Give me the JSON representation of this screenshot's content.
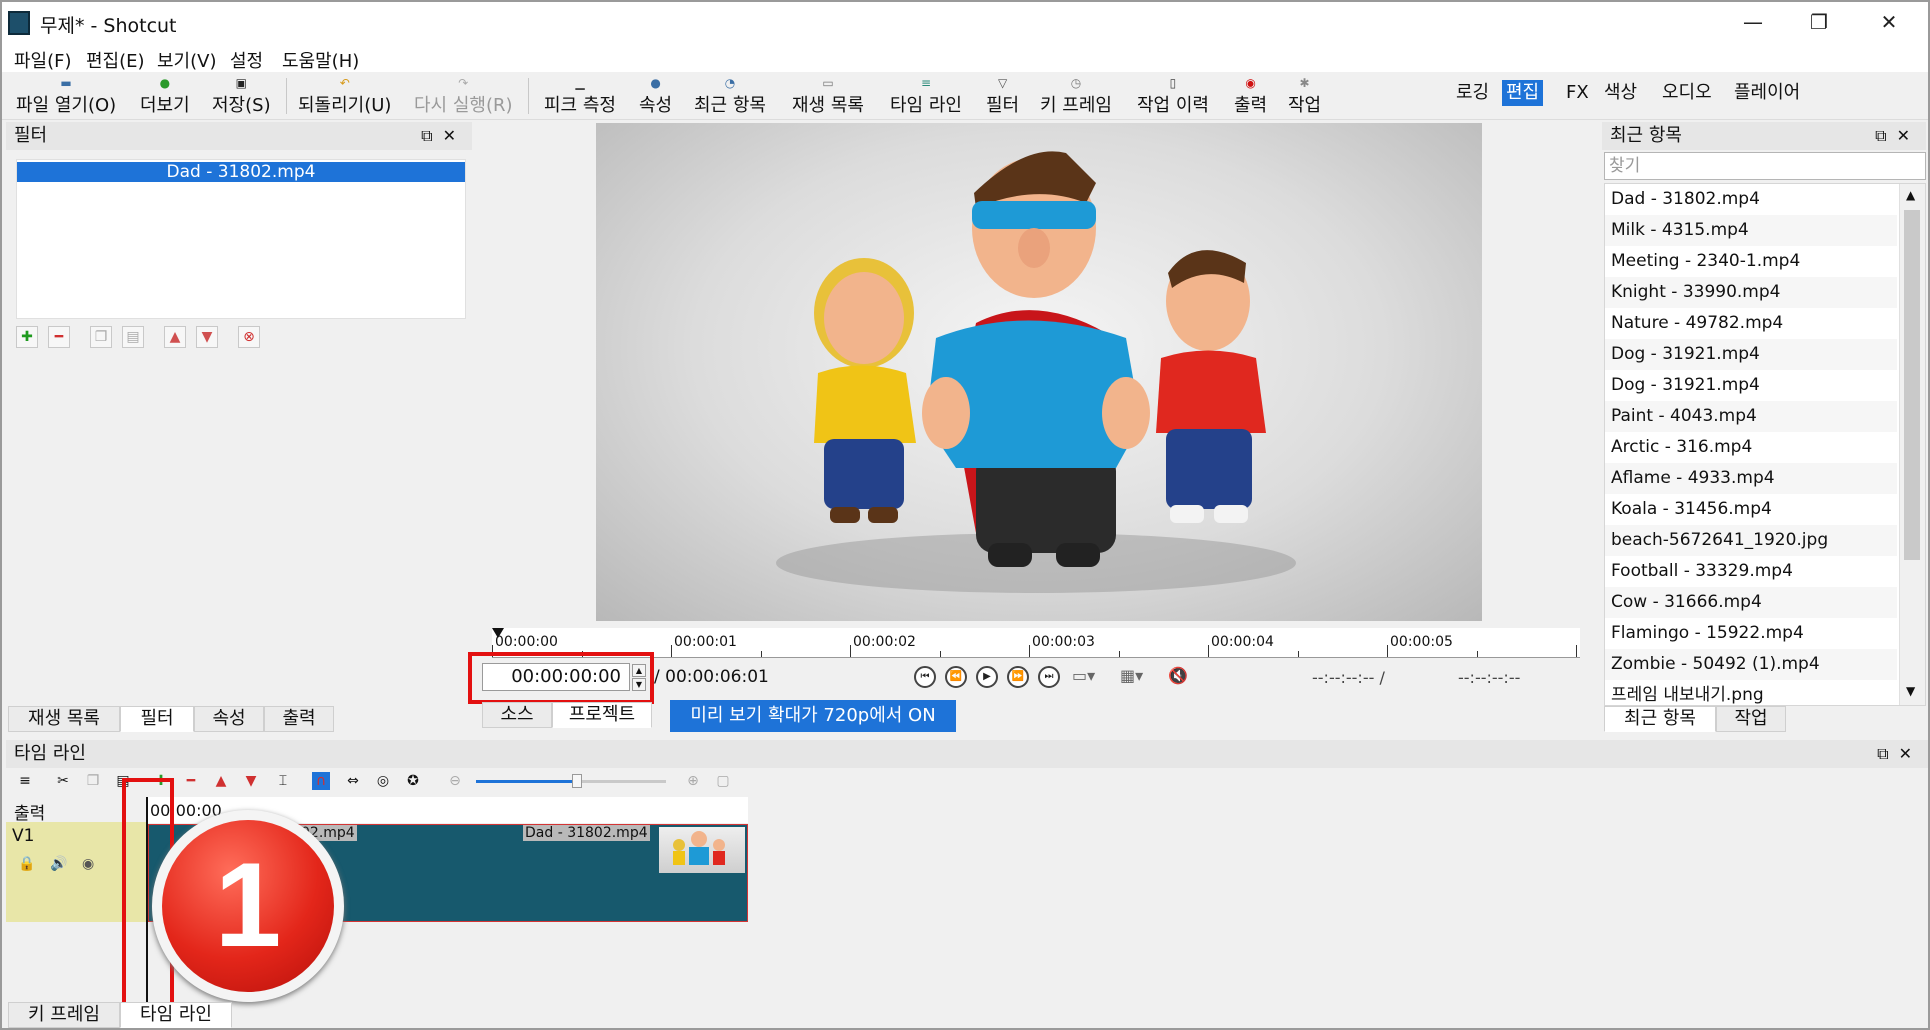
{
  "window": {
    "title": "무제* - Shotcut",
    "minimize": "—",
    "restore": "❐",
    "close": "✕"
  },
  "menu": [
    "파일(F)",
    "편집(E)",
    "보기(V)",
    "설정",
    "도움말(H)"
  ],
  "toolbar": {
    "open": "파일 열기(O)",
    "more": "더보기",
    "save": "저장(S)",
    "undo": "되돌리기(U)",
    "redo": "다시 실행(R)",
    "peak": "피크 측정",
    "properties": "속성",
    "recent": "최근 항목",
    "playlist": "재생 목록",
    "timeline": "타임 라인",
    "filters": "필터",
    "keyframes": "키 프레임",
    "history": "작업 이력",
    "export": "출력",
    "jobs": "작업"
  },
  "layouts": [
    "로깅",
    "편집",
    "FX",
    "색상",
    "오디오",
    "플레이어"
  ],
  "layout_active": "편집",
  "filters_panel": {
    "title": "필터",
    "selected_clip": "Dad - 31802.mp4"
  },
  "left_tabs": [
    "재생 목록",
    "필터",
    "속성",
    "출력"
  ],
  "left_tab_active": "필터",
  "player": {
    "ruler_labels": [
      "00:00:00",
      "00:00:01",
      "00:00:02",
      "00:00:03",
      "00:00:04",
      "00:00:05"
    ],
    "position": "00:00:00:00",
    "duration": "/ 00:00:06:01",
    "in_point": "--:--:--:-- /",
    "out_point": "--:--:--:--",
    "tabs": [
      "소스",
      "프로젝트"
    ],
    "zoom_notice": "미리 보기 확대가 720p에서 ON"
  },
  "recent_panel": {
    "title": "최근 항목",
    "search_placeholder": "찾기",
    "items": [
      "Dad - 31802.mp4",
      "Milk - 4315.mp4",
      "Meeting - 2340-1.mp4",
      "Knight - 33990.mp4",
      "Nature - 49782.mp4",
      "Dog - 31921.mp4",
      "Dog - 31921.mp4",
      "Paint - 4043.mp4",
      "Arctic - 316.mp4",
      "Aflame - 4933.mp4",
      "Koala - 31456.mp4",
      "beach-5672641_1920.jpg",
      "Football - 33329.mp4",
      "Cow - 31666.mp4",
      "Flamingo - 15922.mp4",
      "Zombie - 50492 (1).mp4",
      "프레임 내보내기.png"
    ],
    "tabs": [
      "최근 항목",
      "작업"
    ],
    "tab_active": "최근 항목"
  },
  "timeline": {
    "title": "타임 라인",
    "output_label": "출력",
    "track_label": "V1",
    "ruler_time": "00:00:00",
    "clip_label_left": "02.mp4",
    "clip_label_right": "Dad - 31802.mp4",
    "badge_number": "1"
  },
  "bottom_tabs": [
    "키 프레임",
    "타임 라인"
  ],
  "bottom_tab_active": "타임 라인"
}
